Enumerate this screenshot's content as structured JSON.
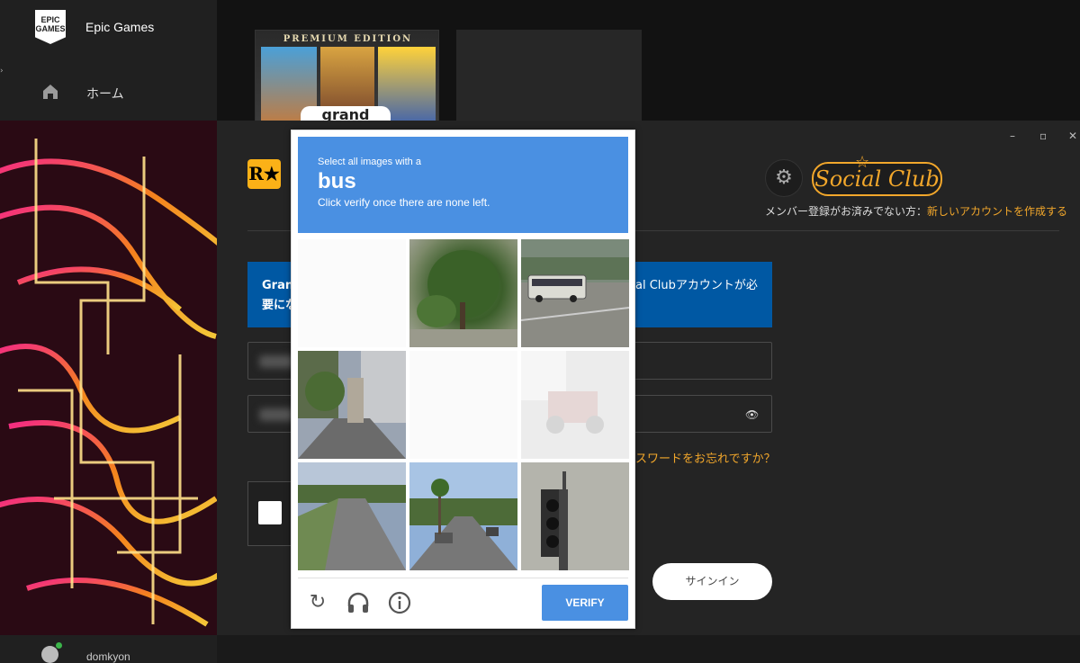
{
  "epic": {
    "brand": "Epic Games",
    "logo_text": "EPIC GAMES",
    "nav_home": "ホーム",
    "username": "domkyon",
    "game_edition": "PREMIUM EDITION",
    "game_title": "grand"
  },
  "rockstar": {
    "logo_text": "R★",
    "social_club": "Social Club",
    "register_prompt": "メンバー登録がお済みでない方：",
    "register_link": "新しいアカウントを作成する",
    "info_left": "Granc\n要にな",
    "info_right": "al Clubアカウントが必",
    "forgot_password": "スワードをお忘れですか？",
    "signin": "サインイン",
    "window_controls": [
      "–",
      "▫",
      "✕"
    ]
  },
  "captcha": {
    "prompt": "Select all images with a",
    "target": "bus",
    "instruction": "Click verify once there are none left.",
    "verify": "VERIFY",
    "tiles": [
      {
        "name": "blank",
        "faded": true
      },
      {
        "name": "tree",
        "faded": false
      },
      {
        "name": "bus-on-road",
        "faded": false
      },
      {
        "name": "city-street",
        "faded": false
      },
      {
        "name": "blank",
        "faded": true
      },
      {
        "name": "motorcycle",
        "faded": true
      },
      {
        "name": "road-trees",
        "faded": false
      },
      {
        "name": "residential-street",
        "faded": false
      },
      {
        "name": "traffic-light",
        "faded": false
      }
    ],
    "icons": [
      "reload-icon",
      "headphones-icon",
      "info-icon"
    ]
  },
  "colors": {
    "captcha_blue": "#4a90e2",
    "rockstar_orange": "#f2a72b",
    "info_blue": "#0058a3"
  }
}
